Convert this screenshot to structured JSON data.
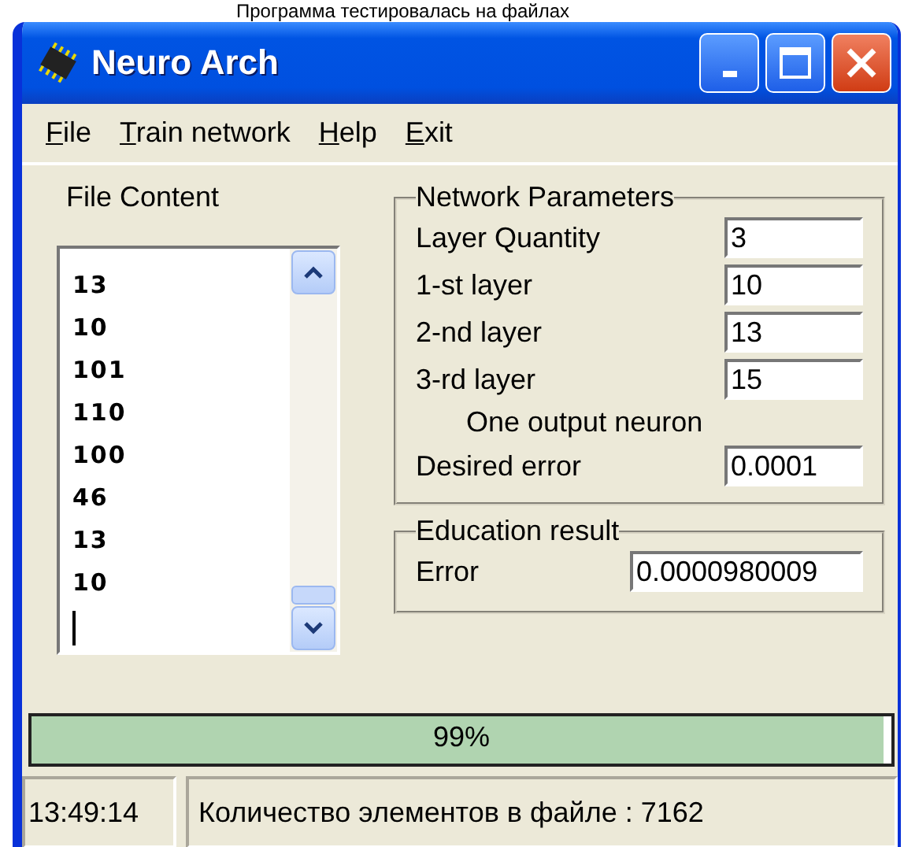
{
  "caption": "Программа тестировалась на файлах",
  "window": {
    "title": "Neuro Arch"
  },
  "menu": [
    {
      "label": "File"
    },
    {
      "label": "Train network"
    },
    {
      "label": "Help"
    },
    {
      "label": "Exit"
    }
  ],
  "file_content": {
    "label": "File Content",
    "lines": [
      "13",
      "10",
      "101",
      "110",
      "100",
      "46",
      "13",
      "10"
    ]
  },
  "network_parameters": {
    "title": "Network Parameters",
    "fields": [
      {
        "label": "Layer Quantity",
        "value": "3"
      },
      {
        "label": "1-st layer",
        "value": "10"
      },
      {
        "label": "2-nd layer",
        "value": "13"
      },
      {
        "label": "3-rd layer",
        "value": "15"
      }
    ],
    "note": "One output neuron",
    "desired_error": {
      "label": "Desired error",
      "value": "0.0001"
    }
  },
  "education_result": {
    "title": "Education result",
    "error": {
      "label": "Error",
      "value": "0.0000980009"
    }
  },
  "progress": {
    "level": 0.99,
    "text": "99%"
  },
  "status_bar": {
    "time": "13:49:14",
    "message": "Количество элементов в файле : 7162"
  }
}
